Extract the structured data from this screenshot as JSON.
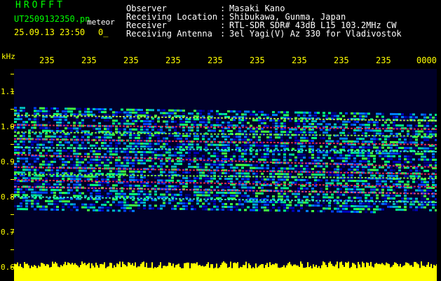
{
  "header": {
    "app_title": "HROFFT",
    "file_name": "UT2509132350.pn",
    "meteor_tag": "meteor",
    "date_time": "25.09.13 23:50",
    "counter": "0_"
  },
  "info": [
    {
      "label": "Observer",
      "value": "Masaki Kano"
    },
    {
      "label": "Receiving Location",
      "value": "Shibukawa, Gunma, Japan"
    },
    {
      "label": "Receiver",
      "value": "RTL-SDR SDR# 43dB L15 103.2MHz CW"
    },
    {
      "label": "Receiving Antenna",
      "value": "3el Yagi(V) Az 330 for Vladivostok"
    }
  ],
  "info_separator": ":",
  "axis": {
    "freq_unit": "kHz",
    "freq_ticks": [
      "1.1",
      "1.0",
      "0.9",
      "0.8",
      "0.7",
      "0.6"
    ],
    "time_ticks": [
      "235",
      "235",
      "235",
      "235",
      "235",
      "235",
      "235",
      "235",
      "235",
      "0000"
    ]
  },
  "colors": {
    "text_header": "#00ff00",
    "axis_text": "#ffff00",
    "info_text": "#ffffff",
    "background": "#000000",
    "spectrogram_bg": "#000028",
    "level_meter": "#ffff00"
  }
}
